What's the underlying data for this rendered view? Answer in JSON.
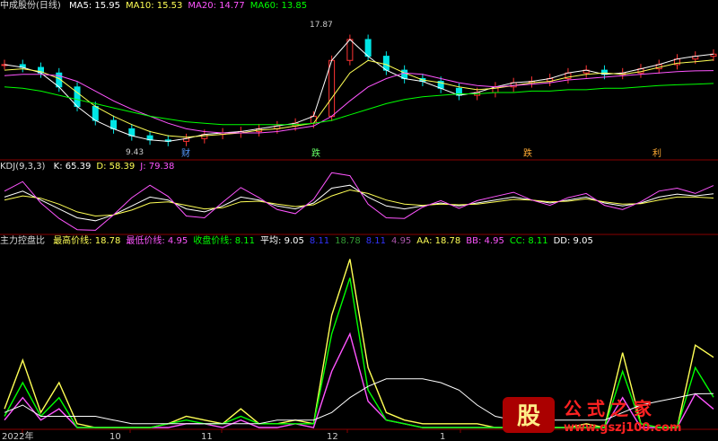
{
  "panel_price": {
    "title": "中成股份(日线)",
    "indicators": [
      {
        "label": "MA5: 15.95",
        "color": "#ffffff"
      },
      {
        "label": "MA10: 15.53",
        "color": "#ffff55"
      },
      {
        "label": "MA20: 14.77",
        "color": "#ff55ff"
      },
      {
        "label": "MA60: 13.85",
        "color": "#00ff00"
      }
    ],
    "annotations": {
      "high": "17.87",
      "low": "9.43"
    },
    "event_markers": [
      "财",
      "跌",
      "跌",
      "利"
    ]
  },
  "panel_kdj": {
    "title": "KDJ(9,3,3)",
    "indicators": [
      {
        "label": "K: 65.39",
        "color": "#ffffff"
      },
      {
        "label": "D: 58.39",
        "color": "#ffff55"
      },
      {
        "label": "J: 79.38",
        "color": "#ff55ff"
      }
    ]
  },
  "panel_ctrl": {
    "title": "主力控盘比",
    "indicators": [
      {
        "label": "最高价线: 18.78",
        "color": "#ffff55"
      },
      {
        "label": "最低价线: 4.95",
        "color": "#ff55ff"
      },
      {
        "label": "收盘价线: 8.11",
        "color": "#00ff00"
      },
      {
        "label": "平均: 9.05",
        "color": "#ffffff"
      },
      {
        "label": "8.11",
        "color": "#3333ff"
      },
      {
        "label": "18.78",
        "color": "#339933"
      },
      {
        "label": "8.11",
        "color": "#3333ff"
      },
      {
        "label": "4.95",
        "color": "#aa55aa"
      },
      {
        "label": "AA: 18.78",
        "color": "#ffff55"
      },
      {
        "label": "BB: 4.95",
        "color": "#ff55ff"
      },
      {
        "label": "CC: 8.11",
        "color": "#00ff00"
      },
      {
        "label": "DD: 9.05",
        "color": "#ffffff"
      }
    ]
  },
  "x_axis_labels": [
    "2022年",
    "10",
    "11",
    "12",
    "1"
  ],
  "watermark": {
    "logo": "股",
    "text": "公式之家",
    "url": "www.gszj100.com"
  },
  "chart_data": [
    {
      "type": "line",
      "panel": "price",
      "note_series": "closing-price path and moving averages",
      "x": [
        0,
        1,
        2,
        3,
        4,
        5,
        6,
        7,
        8,
        9,
        10,
        11,
        12,
        13,
        14,
        15,
        16,
        17,
        18,
        19,
        20,
        21,
        22,
        23,
        24,
        25,
        26,
        27,
        28,
        29,
        30,
        31,
        32,
        33,
        34,
        35,
        36,
        37,
        38,
        39
      ],
      "series": [
        {
          "name": "MA5",
          "values": [
            15.2,
            15.0,
            14.6,
            13.6,
            12.2,
            11.2,
            10.6,
            10.1,
            9.8,
            9.7,
            9.9,
            10.2,
            10.3,
            10.4,
            10.6,
            10.8,
            11.0,
            11.5,
            15.5,
            17.0,
            15.8,
            14.8,
            14.2,
            14.0,
            13.5,
            13.0,
            13.2,
            13.6,
            13.9,
            14.0,
            14.2,
            14.6,
            14.8,
            14.5,
            14.6,
            14.9,
            15.2,
            15.6,
            15.8,
            15.95
          ]
        },
        {
          "name": "MA10",
          "values": [
            14.8,
            14.9,
            14.7,
            14.2,
            13.2,
            12.2,
            11.5,
            10.9,
            10.4,
            10.1,
            10.0,
            10.1,
            10.2,
            10.3,
            10.5,
            10.6,
            10.8,
            11.0,
            12.8,
            14.6,
            15.5,
            15.2,
            14.6,
            14.1,
            13.9,
            13.6,
            13.4,
            13.5,
            13.7,
            13.9,
            14.0,
            14.3,
            14.5,
            14.6,
            14.5,
            14.7,
            15.0,
            15.3,
            15.4,
            15.53
          ]
        },
        {
          "name": "MA20",
          "values": [
            14.4,
            14.5,
            14.5,
            14.4,
            14.0,
            13.3,
            12.6,
            12.0,
            11.5,
            11.0,
            10.6,
            10.4,
            10.3,
            10.3,
            10.3,
            10.4,
            10.6,
            10.8,
            11.5,
            12.6,
            13.6,
            14.2,
            14.6,
            14.5,
            14.2,
            13.9,
            13.7,
            13.6,
            13.7,
            13.8,
            13.9,
            14.1,
            14.2,
            14.3,
            14.4,
            14.5,
            14.6,
            14.7,
            14.75,
            14.77
          ]
        },
        {
          "name": "MA60",
          "values": [
            13.6,
            13.5,
            13.3,
            13.0,
            12.7,
            12.4,
            12.1,
            11.8,
            11.5,
            11.3,
            11.1,
            11.0,
            10.9,
            10.9,
            10.9,
            10.9,
            10.9,
            11.0,
            11.2,
            11.6,
            12.0,
            12.4,
            12.7,
            12.9,
            13.0,
            13.1,
            13.1,
            13.2,
            13.2,
            13.3,
            13.3,
            13.4,
            13.4,
            13.5,
            13.5,
            13.6,
            13.7,
            13.75,
            13.8,
            13.85
          ]
        }
      ],
      "ylim": [
        8.5,
        18.8
      ]
    },
    {
      "type": "line",
      "panel": "kdj",
      "x": [
        0,
        1,
        2,
        3,
        4,
        5,
        6,
        7,
        8,
        9,
        10,
        11,
        12,
        13,
        14,
        15,
        16,
        17,
        18,
        19,
        20,
        21,
        22,
        23,
        24,
        25,
        26,
        27,
        28,
        29,
        30,
        31,
        32,
        33,
        34,
        35,
        36,
        37,
        38,
        39
      ],
      "series": [
        {
          "name": "K",
          "values": [
            60,
            70,
            55,
            40,
            25,
            20,
            30,
            45,
            60,
            55,
            40,
            35,
            45,
            60,
            55,
            45,
            40,
            50,
            75,
            80,
            60,
            45,
            40,
            45,
            50,
            45,
            50,
            55,
            60,
            55,
            50,
            55,
            60,
            50,
            45,
            50,
            60,
            65,
            62,
            65.39
          ]
        },
        {
          "name": "D",
          "values": [
            55,
            62,
            58,
            48,
            35,
            28,
            30,
            38,
            50,
            52,
            46,
            40,
            42,
            52,
            53,
            48,
            44,
            47,
            62,
            72,
            66,
            55,
            48,
            46,
            48,
            47,
            48,
            52,
            56,
            55,
            52,
            53,
            57,
            52,
            48,
            49,
            55,
            60,
            60,
            58.39
          ]
        },
        {
          "name": "J",
          "values": [
            70,
            86,
            50,
            24,
            5,
            4,
            30,
            59,
            80,
            61,
            28,
            25,
            51,
            76,
            59,
            39,
            32,
            56,
            101,
            96,
            48,
            25,
            24,
            43,
            54,
            41,
            54,
            61,
            68,
            55,
            46,
            59,
            66,
            46,
            39,
            52,
            70,
            75,
            66,
            79.38
          ]
        }
      ],
      "ylim": [
        0,
        100
      ]
    },
    {
      "type": "line",
      "panel": "ctrl",
      "x": [
        0,
        1,
        2,
        3,
        4,
        5,
        6,
        7,
        8,
        9,
        10,
        11,
        12,
        13,
        14,
        15,
        16,
        17,
        18,
        19,
        20,
        21,
        22,
        23,
        24,
        25,
        26,
        27,
        28,
        29,
        30,
        31,
        32,
        33,
        34,
        35,
        36,
        37,
        38,
        39
      ],
      "series": [
        {
          "name": "AA",
          "values": [
            5,
            18,
            4,
            12,
            1,
            0,
            0,
            0,
            0,
            1,
            3,
            2,
            1,
            5,
            1,
            1,
            2,
            1,
            30,
            45,
            16,
            4,
            2,
            1,
            1,
            1,
            1,
            0,
            0,
            0,
            0,
            0,
            1,
            0,
            20,
            1,
            0,
            0,
            22,
            18.78
          ]
        },
        {
          "name": "BB",
          "values": [
            2,
            8,
            2,
            5,
            0,
            0,
            0,
            0,
            0,
            0,
            1,
            1,
            0,
            2,
            0,
            0,
            1,
            0,
            15,
            25,
            7,
            2,
            1,
            0,
            0,
            0,
            0,
            0,
            0,
            0,
            0,
            0,
            0,
            0,
            8,
            0,
            0,
            0,
            9,
            4.95
          ]
        },
        {
          "name": "CC",
          "values": [
            3,
            12,
            3,
            8,
            0,
            0,
            0,
            0,
            0,
            1,
            2,
            1,
            1,
            3,
            1,
            1,
            1,
            1,
            25,
            40,
            10,
            2,
            1,
            0,
            0,
            0,
            0,
            0,
            0,
            0,
            0,
            0,
            0,
            0,
            15,
            1,
            0,
            0,
            16,
            8.11
          ]
        },
        {
          "name": "DD",
          "values": [
            4,
            6,
            3,
            3,
            3,
            3,
            2,
            1,
            1,
            1,
            1,
            1,
            1,
            1,
            1,
            2,
            2,
            2,
            4,
            8,
            11,
            13,
            13,
            13,
            12,
            10,
            6,
            3,
            2,
            2,
            2,
            2,
            2,
            2,
            4,
            6,
            7,
            8,
            9,
            9.05
          ]
        }
      ],
      "ylim": [
        0,
        48
      ]
    }
  ]
}
